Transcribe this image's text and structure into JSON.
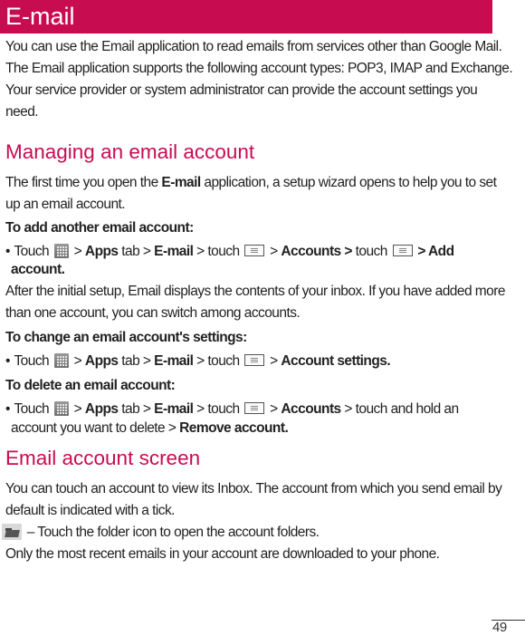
{
  "header": {
    "title": "E-mail",
    "accent_color": "#c80c50"
  },
  "intro": [
    "You can use the Email application to read emails from services other than Google Mail.",
    "The Email application supports the following account types: POP3, IMAP and Exchange.",
    "Your service provider or system administrator can provide the account settings you",
    "need."
  ],
  "managing": {
    "heading": "Managing an email account",
    "p1_a": "The first time you open the ",
    "p1_b": "E-mail",
    "p1_c": " application, a setup wizard opens to help you to set",
    "p1_line2": "up an email account.",
    "add": {
      "subheading": "To add another email account:",
      "bullet": "•",
      "touch": "Touch",
      "gt": ">",
      "apps": "Apps",
      "tab": "tab >",
      "email": "E-mail",
      "touch2": "> touch",
      "accounts": "Accounts >",
      "touch3": "touch",
      "add_account_1": "> Add",
      "add_account_2": "account."
    },
    "after_1": "After the initial setup, Email displays the contents of your inbox. If you have added more",
    "after_2": "than one account, you can switch among accounts.",
    "change": {
      "subheading": "To change an email account's settings:",
      "touch": "Touch",
      "gt": ">",
      "apps": "Apps",
      "tab": "tab >",
      "email": "E-mail",
      "touch2": "> touch",
      "gt2": ">",
      "account_settings": "Account settings."
    },
    "delete": {
      "subheading": "To delete an email account:",
      "touch": "Touch",
      "gt": ">",
      "apps": "Apps",
      "tab": "tab >",
      "email": "E-mail",
      "touch2": "> touch",
      "gt2": ">",
      "accounts": "Accounts",
      "rest": " > touch and hold an",
      "line2_a": "account you want to delete > ",
      "remove": "Remove account."
    }
  },
  "screen": {
    "heading": "Email account screen",
    "p1": "You can touch an account to view its Inbox. The account from which you send email by",
    "p2": "default is indicated with a tick.",
    "folder_text": " – Touch the folder icon to open the account folders.",
    "p3": "Only the most recent emails in your account are downloaded to your phone."
  },
  "icons": {
    "apps": "apps-grid-icon",
    "menu": "menu-key-icon",
    "folder": "folder-icon"
  },
  "page_number": "49"
}
